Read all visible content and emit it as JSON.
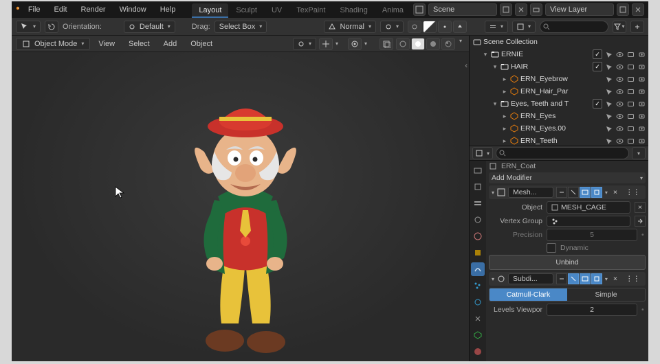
{
  "menubar": {
    "items": [
      "File",
      "Edit",
      "Render",
      "Window",
      "Help"
    ]
  },
  "workspaces": {
    "tabs": [
      "Layout",
      "Sculpt",
      "UV",
      "TexPaint",
      "Shading",
      "Anima"
    ],
    "active": 0
  },
  "scene": {
    "label": "Scene",
    "viewlayer_label": "View Layer"
  },
  "toolbar": {
    "orientation_label": "Orientation:",
    "orientation_value": "Default",
    "drag_label": "Drag:",
    "drag_value": "Select Box",
    "normal_label": "Normal"
  },
  "viewport_header": {
    "mode": "Object Mode",
    "items": [
      "View",
      "Select",
      "Add",
      "Object"
    ]
  },
  "outliner": {
    "root": "Scene Collection",
    "rows": [
      {
        "indent": 2,
        "toggle": "▾",
        "icon": "collection",
        "name": "ERNIE",
        "chk": true
      },
      {
        "indent": 3,
        "toggle": "▾",
        "icon": "collection",
        "name": "HAIR",
        "chk": true
      },
      {
        "indent": 4,
        "toggle": "▸",
        "icon": "mesh",
        "name": "ERN_Eyebrow",
        "chk": false
      },
      {
        "indent": 4,
        "toggle": "▸",
        "icon": "mesh",
        "name": "ERN_Hair_Par",
        "chk": false
      },
      {
        "indent": 3,
        "toggle": "▾",
        "icon": "collection",
        "name": "Eyes, Teeth and T",
        "chk": true
      },
      {
        "indent": 4,
        "toggle": "▸",
        "icon": "mesh",
        "name": "ERN_Eyes",
        "chk": false
      },
      {
        "indent": 4,
        "toggle": "▸",
        "icon": "mesh",
        "name": "ERN_Eyes.00",
        "chk": false
      },
      {
        "indent": 4,
        "toggle": "▸",
        "icon": "mesh",
        "name": "ERN_Teeth",
        "chk": false
      }
    ]
  },
  "props": {
    "breadcrumb": "ERN_Coat",
    "add_modifier": "Add Modifier",
    "mod1_name": "Mesh...",
    "object_label": "Object",
    "object_value": "MESH_CAGE",
    "vertex_group_label": "Vertex Group",
    "precision_label": "Precision",
    "precision_value": "5",
    "dynamic_label": "Dynamic",
    "unbind": "Unbind",
    "mod2_name": "Subdi...",
    "seg_a": "Catmull-Clark",
    "seg_b": "Simple",
    "levels_label": "Levels Viewpor",
    "levels_value": "2"
  },
  "colors": {
    "accent": "#4a88c7"
  }
}
